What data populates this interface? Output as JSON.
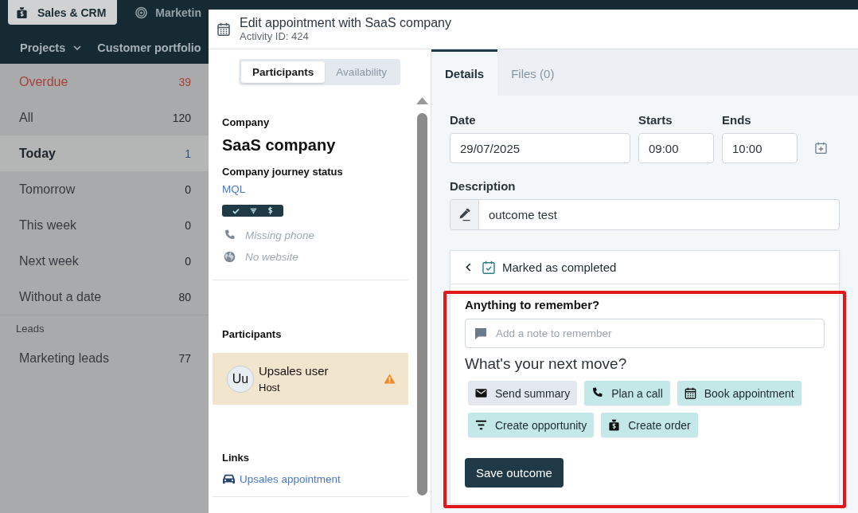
{
  "top_nav": {
    "tabs": [
      {
        "label": "Sales & CRM",
        "selected": true
      },
      {
        "label": "Marketin",
        "selected": false
      }
    ]
  },
  "sub_nav": {
    "items": [
      {
        "label": "Projects",
        "dropdown": true
      },
      {
        "label": "Customer portfolio",
        "dropdown": false
      }
    ]
  },
  "sidebar": {
    "groups": [
      {
        "items": [
          {
            "label": "Overdue",
            "count": "39",
            "selected": false,
            "overdue": true
          },
          {
            "label": "All",
            "count": "120",
            "selected": false,
            "overdue": false
          },
          {
            "label": "Today",
            "count": "1",
            "selected": true,
            "overdue": false
          },
          {
            "label": "Tomorrow",
            "count": "0",
            "selected": false,
            "overdue": false
          },
          {
            "label": "This week",
            "count": "0",
            "selected": false,
            "overdue": false
          },
          {
            "label": "Next week",
            "count": "0",
            "selected": false,
            "overdue": false
          },
          {
            "label": "Without a date",
            "count": "80",
            "selected": false,
            "overdue": false
          }
        ]
      },
      {
        "title": "Leads",
        "items": [
          {
            "label": "Marketing leads",
            "count": "77",
            "selected": false,
            "overdue": false
          }
        ]
      }
    ]
  },
  "modal": {
    "title": "Edit appointment with SaaS company",
    "subtitle": "Activity ID: 424",
    "left_panel": {
      "segments": [
        {
          "label": "Participants",
          "selected": true
        },
        {
          "label": "Availability",
          "selected": false
        }
      ],
      "company": {
        "label": "Company",
        "name": "SaaS company",
        "journey_label": "Company journey status",
        "journey_status": "MQL"
      },
      "contact_info": [
        {
          "kind": "phone",
          "text": "Missing phone",
          "missing": true
        },
        {
          "kind": "website",
          "text": "No website",
          "missing": true
        }
      ],
      "participants": {
        "title": "Participants",
        "items": [
          {
            "initials": "Uu",
            "name": "Upsales user",
            "role": "Host",
            "warning": true
          }
        ]
      },
      "links": {
        "title": "Links",
        "items": [
          {
            "label": "Upsales appointment"
          }
        ]
      }
    },
    "right_panel": {
      "tabs": [
        {
          "label": "Details",
          "selected": true
        },
        {
          "label": "Files (0)",
          "selected": false
        }
      ],
      "time_fields": [
        {
          "label": "Date",
          "value": "29/07/2025"
        },
        {
          "label": "Starts",
          "value": "09:00"
        },
        {
          "label": "Ends",
          "value": "10:00"
        }
      ],
      "description": {
        "label": "Description",
        "value": "outcome test"
      },
      "outcome": {
        "status": "Marked as completed",
        "annotated": true,
        "note": {
          "label": "Anything to remember?",
          "placeholder": "Add a note to remember"
        },
        "next_move_title": "What's your next move?",
        "actions": [
          {
            "label": "Send summary",
            "highlighted": false
          },
          {
            "label": "Plan a call",
            "highlighted": true
          },
          {
            "label": "Book appointment",
            "highlighted": true
          },
          {
            "label": "Create opportunity",
            "highlighted": true
          },
          {
            "label": "Create order",
            "highlighted": true
          }
        ],
        "save_label": "Save outcome"
      }
    }
  }
}
